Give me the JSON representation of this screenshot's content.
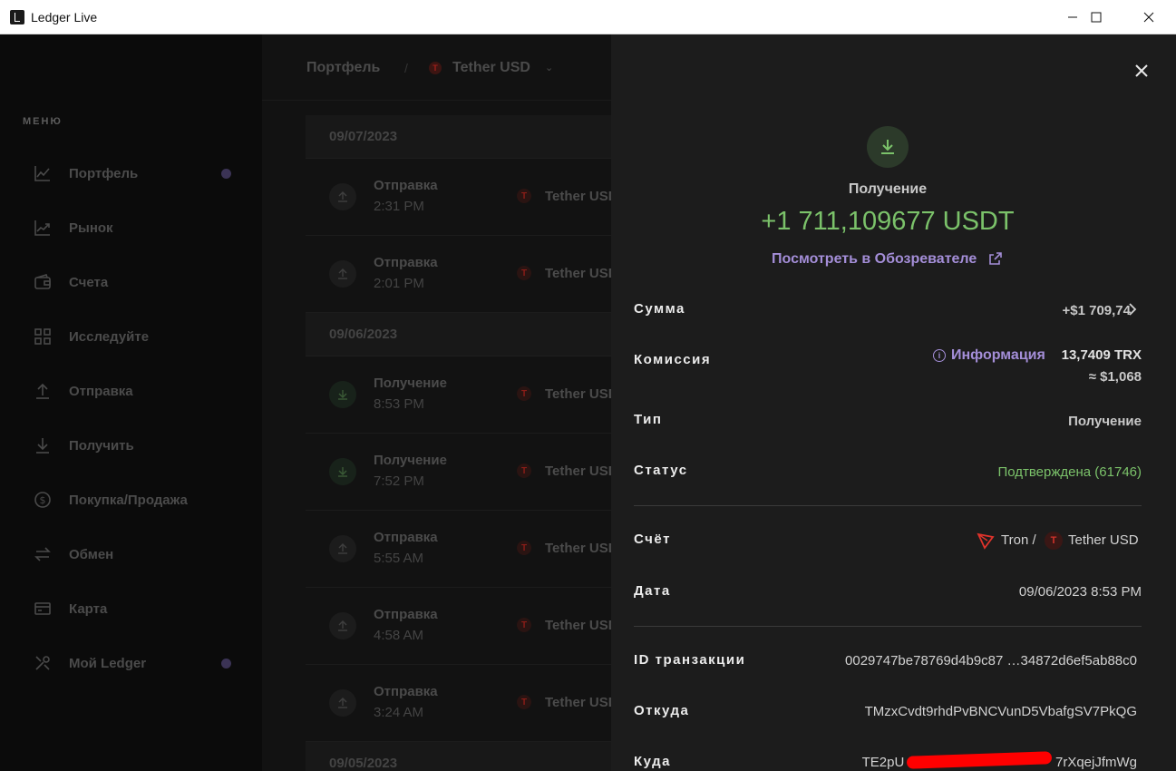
{
  "window": {
    "title": "Ledger Live"
  },
  "sidebar": {
    "menu_title": "МЕНЮ",
    "items": [
      {
        "label": "Портфель",
        "icon": "chart-line-icon",
        "dot": true
      },
      {
        "label": "Рынок",
        "icon": "market-trend-icon",
        "dot": false
      },
      {
        "label": "Счета",
        "icon": "wallet-icon",
        "dot": false
      },
      {
        "label": "Исследуйте",
        "icon": "grid-icon",
        "dot": false
      },
      {
        "label": "Отправка",
        "icon": "arrow-up-icon",
        "dot": false
      },
      {
        "label": "Получить",
        "icon": "arrow-down-icon",
        "dot": false
      },
      {
        "label": "Покупка/Продажа",
        "icon": "dollar-circle-icon",
        "dot": false
      },
      {
        "label": "Обмен",
        "icon": "swap-icon",
        "dot": false
      },
      {
        "label": "Карта",
        "icon": "card-icon",
        "dot": false
      },
      {
        "label": "Мой Ledger",
        "icon": "tools-icon",
        "dot": true
      }
    ]
  },
  "breadcrumb": {
    "root": "Портфель",
    "separator": "/",
    "current": "Tether USD",
    "token_letter": "T"
  },
  "operations": {
    "dates": [
      "09/07/2023",
      "09/06/2023",
      "09/05/2023"
    ],
    "rows": [
      {
        "type": "Отправка",
        "time": "2:31 PM",
        "asset": "Tether USD"
      },
      {
        "type": "Отправка",
        "time": "2:01 PM",
        "asset": "Tether USD"
      },
      {
        "type": "Получение",
        "time": "8:53 PM",
        "asset": "Tether USD"
      },
      {
        "type": "Получение",
        "time": "7:52 PM",
        "asset": "Tether USD"
      },
      {
        "type": "Отправка",
        "time": "5:55 AM",
        "asset": "Tether USD"
      },
      {
        "type": "Отправка",
        "time": "4:58 AM",
        "asset": "Tether USD"
      },
      {
        "type": "Отправка",
        "time": "3:24 AM",
        "asset": "Tether USD"
      }
    ]
  },
  "detail": {
    "type": "Получение",
    "amount": "+1 711,109677 USDT",
    "explorer_link": "Посмотреть в Обозревателе",
    "fields": {
      "amount_label": "Сумма",
      "amount_value": "+$1 709,74",
      "fee_label": "Комиссия",
      "fee_info": "Информация",
      "fee_value": "13,7409 TRX",
      "fee_fiat": "≈ $1,068",
      "type_label": "Тип",
      "type_value": "Получение",
      "status_label": "Статус",
      "status_value": "Подтверждена (61746)",
      "account_label": "Счёт",
      "account_chain": "Tron /",
      "account_token": "Tether USD",
      "date_label": "Дата",
      "date_value": "09/06/2023 8:53 PM",
      "txid_label": "ID транзакции",
      "txid_value": "0029747be78769d4b9c87 …34872d6ef5ab88c0",
      "from_label": "Откуда",
      "from_value": "TMzxCvdt9rhdPvBNCVunD5VbafgSV7PkQG",
      "to_label": "Куда",
      "to_value": "TE2pU                                        7rXqejJfmWg"
    },
    "colors": {
      "accent": "#a48ed8",
      "positive": "#7bc26a",
      "token_red": "#d2322a"
    }
  }
}
